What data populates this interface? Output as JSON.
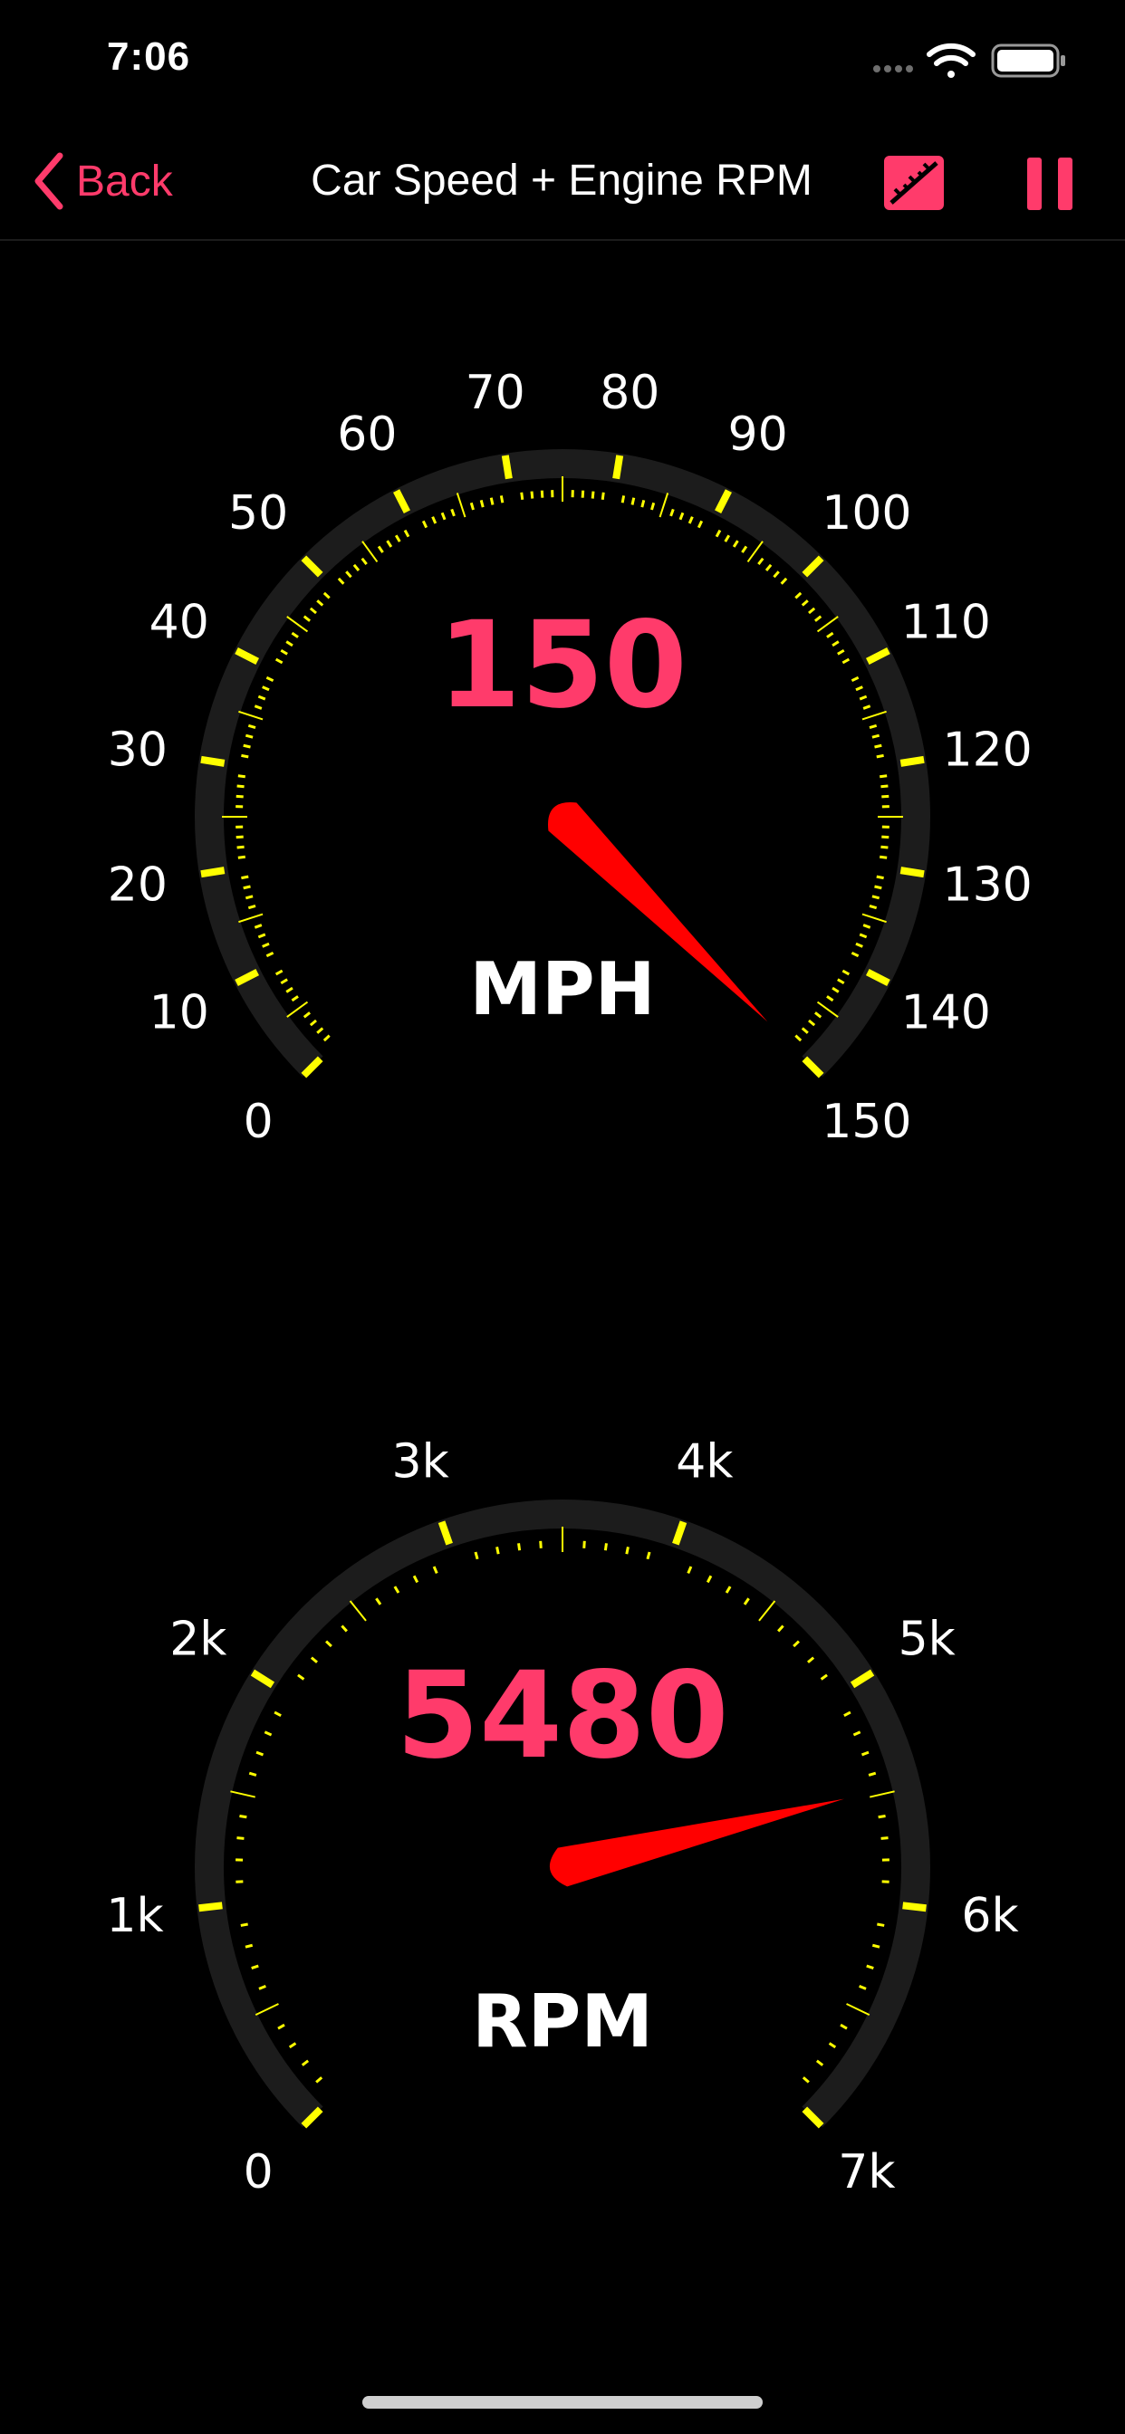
{
  "status_bar": {
    "time": "7:06",
    "icons": [
      "signal-dots-icon",
      "wifi-icon",
      "battery-icon"
    ]
  },
  "nav": {
    "back_label": "Back",
    "title": "Car Speed + Engine RPM",
    "icons": [
      "chevron-left-icon",
      "ruler-icon",
      "pause-icon"
    ]
  },
  "colors": {
    "accent": "#ff3b6b",
    "tick_yellow": "#ffff00",
    "needle": "#ff0000",
    "track": "#1c1c1c",
    "background": "#000000"
  },
  "gauges": [
    {
      "id": "speed",
      "unit": "MPH",
      "value": "150",
      "needle_value": 150,
      "min": 0,
      "max": 150,
      "major_labels": [
        "0",
        "10",
        "20",
        "30",
        "40",
        "50",
        "60",
        "70",
        "80",
        "90",
        "100",
        "110",
        "120",
        "130",
        "140",
        "150"
      ]
    },
    {
      "id": "rpm",
      "unit": "RPM",
      "value": "5480",
      "needle_value": 5480,
      "min": 0,
      "max": 7000,
      "major_labels": [
        "0",
        "1k",
        "2k",
        "3k",
        "4k",
        "5k",
        "6k",
        "7k"
      ]
    }
  ]
}
